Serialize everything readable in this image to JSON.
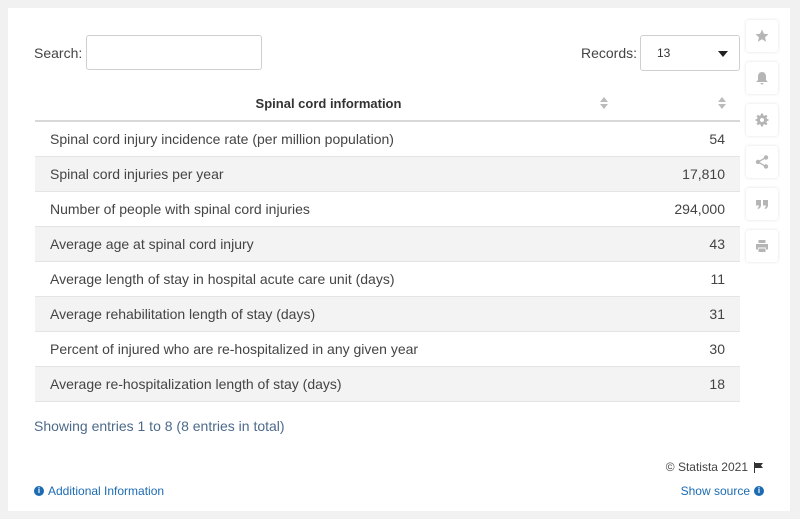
{
  "search": {
    "label": "Search:",
    "value": "",
    "placeholder": ""
  },
  "records": {
    "label": "Records:",
    "value": "13"
  },
  "table": {
    "header": "Spinal cord information",
    "rows": [
      {
        "label": "Spinal cord injury incidence rate (per million population)",
        "value": "54"
      },
      {
        "label": "Spinal cord injuries per year",
        "value": "17,810"
      },
      {
        "label": "Number of people with spinal cord injuries",
        "value": "294,000"
      },
      {
        "label": "Average age at spinal cord injury",
        "value": "43"
      },
      {
        "label": "Average length of stay in hospital acute care unit (days)",
        "value": "11"
      },
      {
        "label": "Average rehabilitation length of stay (days)",
        "value": "31"
      },
      {
        "label": "Percent of injured who are re-hospitalized in any given year",
        "value": "30"
      },
      {
        "label": "Average re-hospitalization length of stay (days)",
        "value": "18"
      }
    ]
  },
  "footer": {
    "showing": "Showing entries 1 to 8 (8 entries in total)",
    "copyright": "© Statista 2021",
    "additional_info": "Additional Information",
    "show_source": "Show source"
  },
  "sidebar_icons": [
    "star-icon",
    "bell-icon",
    "gear-icon",
    "share-icon",
    "quote-icon",
    "print-icon"
  ]
}
